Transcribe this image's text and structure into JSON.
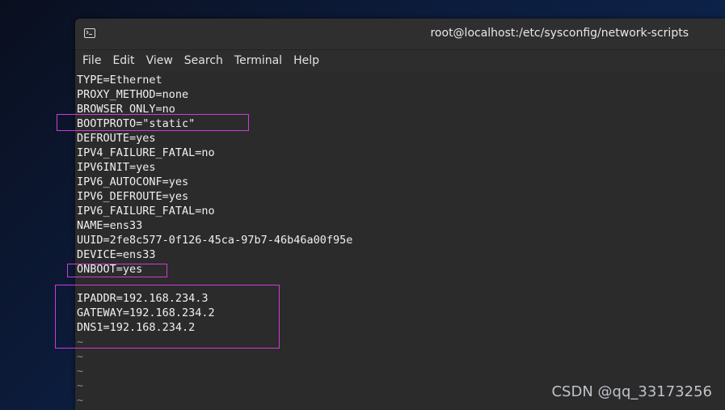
{
  "window": {
    "title": "root@localhost:/etc/sysconfig/network-scripts",
    "icon": "terminal-icon"
  },
  "menu": {
    "items": [
      "File",
      "Edit",
      "View",
      "Search",
      "Terminal",
      "Help"
    ]
  },
  "terminal": {
    "lines": [
      "TYPE=Ethernet",
      "PROXY_METHOD=none",
      "BROWSER_ONLY=no",
      "BOOTPROTO=\"static\"",
      "DEFROUTE=yes",
      "IPV4_FAILURE_FATAL=no",
      "IPV6INIT=yes",
      "IPV6_AUTOCONF=yes",
      "IPV6_DEFROUTE=yes",
      "IPV6_FAILURE_FATAL=no",
      "NAME=ens33",
      "UUID=2fe8c577-0f126-45ca-97b7-46b46a00f95e",
      "DEVICE=ens33",
      "ONBOOT=yes",
      "",
      "IPADDR=192.168.234.3",
      "GATEWAY=192.168.234.2",
      "DNS1=192.168.234.2",
      "~",
      "~",
      "~",
      "~",
      "~"
    ],
    "highlight_color": "#d23ad6"
  },
  "watermark": {
    "text": "CSDN @qq_33173256"
  }
}
